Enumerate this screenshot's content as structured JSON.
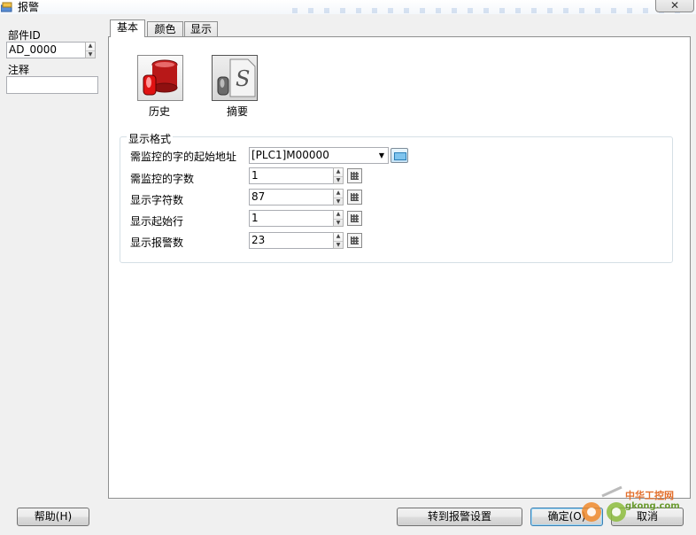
{
  "window": {
    "title": "报警",
    "close_label": "✕"
  },
  "left": {
    "part_id_label": "部件ID",
    "part_id_value": "AD_0000",
    "comment_label": "注释",
    "comment_value": ""
  },
  "tabs": [
    {
      "label": "基本",
      "active": true
    },
    {
      "label": "颜色",
      "active": false
    },
    {
      "label": "显示",
      "active": false
    }
  ],
  "mode_buttons": [
    {
      "label": "历史",
      "icon": "database-alarm-icon",
      "selected": false
    },
    {
      "label": "摘要",
      "icon": "summary-s-icon",
      "selected": true
    }
  ],
  "display_format": {
    "title": "显示格式",
    "start_address_label": "需监控的字的起始地址",
    "start_address_value": "[PLC1]M00000",
    "word_count_label": "需监控的字数",
    "word_count_value": "1",
    "char_count_label": "显示字符数",
    "char_count_value": "87",
    "start_row_label": "显示起始行",
    "start_row_value": "1",
    "alarm_count_label": "显示报警数",
    "alarm_count_value": "23"
  },
  "footer": {
    "help_label": "帮助(H)",
    "goto_alarm_label": "转到报警设置",
    "ok_label": "确定(O)",
    "cancel_label": "取消"
  },
  "watermark": {
    "line1": "中华工控网",
    "line2": "gkong.com"
  },
  "colors": {
    "accent": "#3c7fb1",
    "alarm_red": "#d01010",
    "watermark_orange": "#e3702d"
  }
}
